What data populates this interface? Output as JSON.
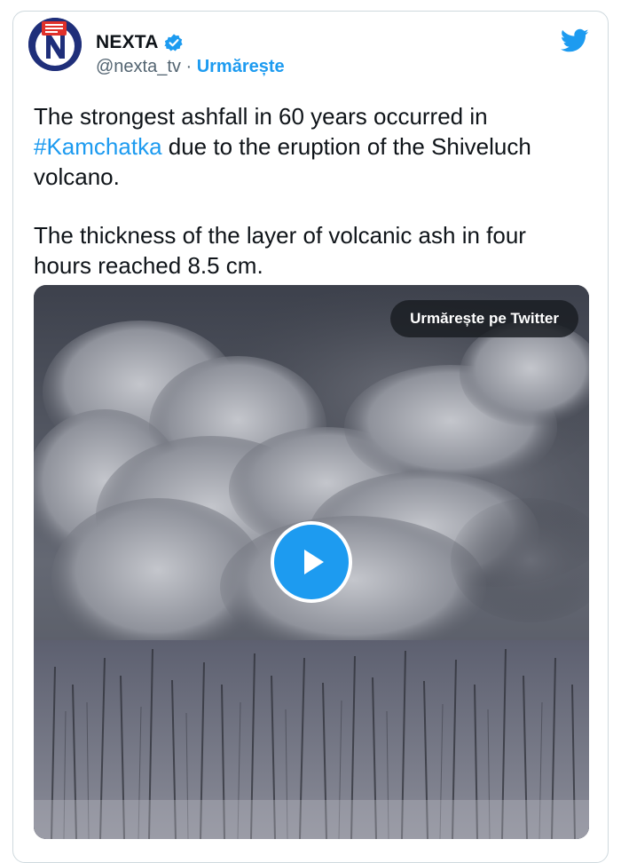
{
  "author": {
    "display_name": "NEXTA",
    "handle": "@nexta_tv",
    "separator": " · ",
    "follow_label": "Urmărește",
    "avatar_icon": "nexta-logo-icon",
    "verified_icon": "verified-badge-icon"
  },
  "header": {
    "brand_icon": "twitter-bird-icon"
  },
  "tweet": {
    "paragraph1_part1": "The strongest ashfall in 60 years occurred in ",
    "hashtag": "#Kamchatka",
    "paragraph1_part2": " due to the eruption of the Shiveluch volcano.",
    "paragraph2": "The thickness of the layer of volcanic ash in four hours reached 8.5 cm."
  },
  "media": {
    "watch_label": "Urmărește pe Twitter",
    "play_icon": "play-icon"
  },
  "colors": {
    "accent": "#1d9bf0",
    "text": "#0f1419",
    "muted": "#536471",
    "border": "#cfd9de"
  }
}
